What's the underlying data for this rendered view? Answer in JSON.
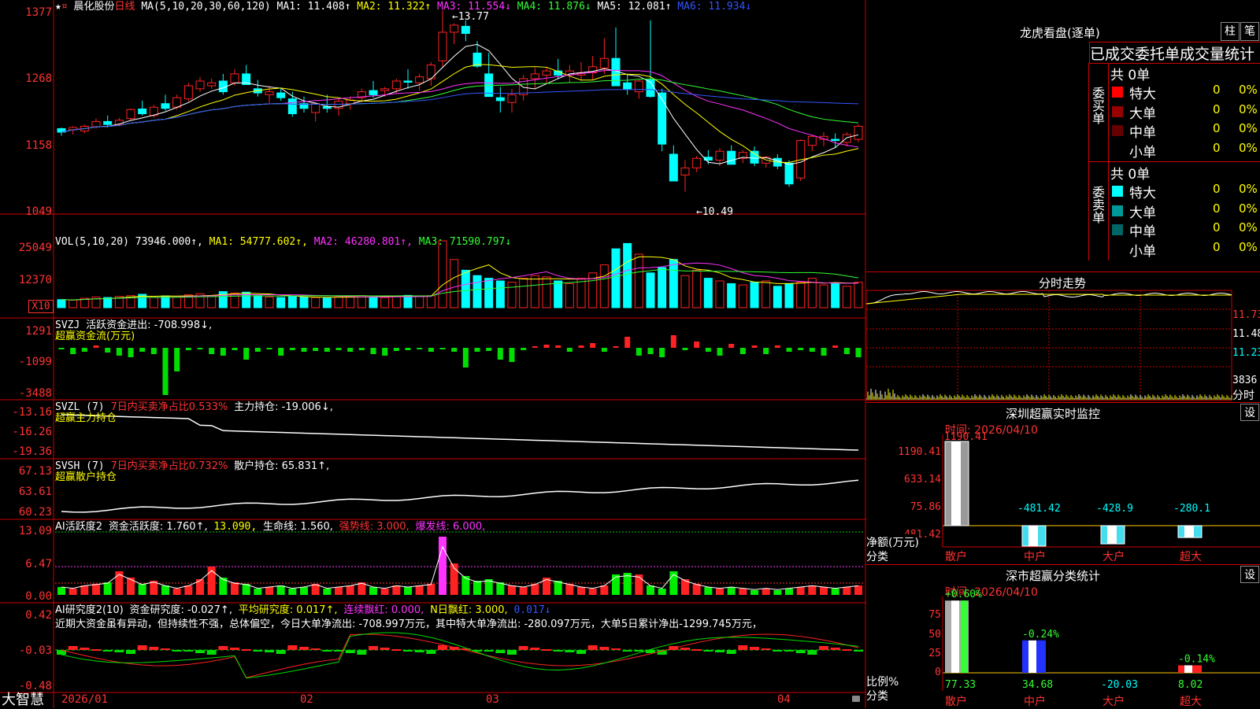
{
  "stock": {
    "name": "晨化股份",
    "period": "日线",
    "ma_header": "MA(5,10,20,30,60,120)",
    "ma": [
      {
        "label": "MA1: 11.408↑",
        "color": "#ffffff"
      },
      {
        "label": "MA2: 11.322↑",
        "color": "#ffff00"
      },
      {
        "label": "MA3: 11.554↓",
        "color": "#ff33ff"
      },
      {
        "label": "MA4: 11.876↓",
        "color": "#33ff33"
      },
      {
        "label": "MA5: 12.081↑",
        "color": "#ffffff"
      },
      {
        "label": "MA6: 11.934↓",
        "color": "#3355ff"
      }
    ],
    "high_mark": "←13.77",
    "low_mark": "←10.49",
    "price_axis": [
      "1377",
      "1268",
      "1158",
      "1049"
    ]
  },
  "vol": {
    "header": "VOL(5,10,20)",
    "value": "73946.000↑,",
    "ma1": "MA1: 54777.602↑,",
    "ma2": "MA2: 46280.801↑,",
    "ma3": "MA3: 71590.797↓",
    "axis": [
      "25049",
      "12370"
    ],
    "unit": "X10"
  },
  "svzj": {
    "header": "SVZJ",
    "line1": "活跃资金进出: -708.998↓,",
    "line2": "超赢资金流(万元)",
    "axis": [
      "1291",
      "-1099",
      "-3488"
    ]
  },
  "svzl": {
    "header": "SVZL (7)",
    "desc": "7日内买卖净占比0.533%",
    "val": "主力持仓: -19.006↓,",
    "line2": "超赢主力持仓",
    "axis": [
      "-13.16",
      "-16.26",
      "-19.36"
    ]
  },
  "svsh": {
    "header": "SVSH (7)",
    "desc": "7日内买卖净占比0.732%",
    "val": "散户持仓: 65.831↑,",
    "line2": "超赢散户持仓",
    "axis": [
      "67.13",
      "63.61",
      "60.23"
    ]
  },
  "ai1": {
    "header": "AI活跃度2",
    "a": "资金活跃度: 1.760↑,",
    "b": "13.090,",
    "c": "生命线: 1.560,",
    "d": "强势线: 3.000,",
    "e": "爆发线: 6.000,",
    "axis": [
      "13.09",
      "6.47",
      "0.00"
    ]
  },
  "ai2": {
    "header": "AI研究度2(10)",
    "a": "资金研究度: -0.027↑,",
    "b": "平均研究度: 0.017↑,",
    "c": "连续飘红: 0.000,",
    "d": "N日飘红: 3.000,",
    "e": "0.017↓",
    "summary": "近期大资金虽有异动，但持续性不强，总体偏空，今日大单净流出: -708.997万元，其中特大单净流出: -280.097万元，大单5日累计净出-1299.745万元，",
    "axis": [
      "0.42",
      "-0.03",
      "-0.48"
    ]
  },
  "footer": {
    "brand": "大智慧",
    "dates": [
      "2026/01",
      "02",
      "03",
      "04"
    ]
  },
  "lhb": {
    "title": "龙虎看盘(逐单)",
    "btn1": "柱",
    "btn2": "笔",
    "tabs": "已成交委托单成交量统计",
    "buy_label": "委买单",
    "sell_label": "委卖单",
    "buy_total": "共 0单",
    "sell_total": "共 0单",
    "buy_rows": [
      {
        "name": "特大",
        "count": "0",
        "pct": "0%",
        "color": "#ff0000"
      },
      {
        "name": "大单",
        "count": "0",
        "pct": "0%",
        "color": "#990000"
      },
      {
        "name": "中单",
        "count": "0",
        "pct": "0%",
        "color": "#660000"
      },
      {
        "name": "小单",
        "count": "0",
        "pct": "0%",
        "color": "#000000"
      }
    ],
    "sell_rows": [
      {
        "name": "特大",
        "count": "0",
        "pct": "0%",
        "color": "#00ffff"
      },
      {
        "name": "大单",
        "count": "0",
        "pct": "0%",
        "color": "#009999"
      },
      {
        "name": "中单",
        "count": "0",
        "pct": "0%",
        "color": "#006666"
      },
      {
        "name": "小单",
        "count": "0",
        "pct": "0%",
        "color": "#000000"
      }
    ]
  },
  "intraday": {
    "title": "分时走势",
    "axis": [
      "11.73",
      "11.48",
      "11.23",
      "3836"
    ],
    "unit": "分时"
  },
  "monitor": {
    "title": "深圳超赢实时监控",
    "btn": "设",
    "time": "时间: 2026/04/10",
    "axis": [
      "1190.41",
      "633.14",
      "75.86",
      "-481.42"
    ],
    "ylabel": "净额(万元)",
    "xlabel": "分类",
    "cats": [
      "散户",
      "中户",
      "大户",
      "超大"
    ],
    "values": [
      1190.41,
      -481.42,
      -428.9,
      -280.1
    ],
    "value_labels": [
      "1190.41",
      "-481.42",
      "-428.9",
      "-280.1"
    ]
  },
  "classify": {
    "title": "深市超赢分类统计",
    "btn": "设",
    "time": "时间: 2026/04/10",
    "axis": [
      "75",
      "50",
      "25",
      "0"
    ],
    "ylabel": "比例%",
    "xlabel": "分类",
    "cats": [
      "散户",
      "中户",
      "大户",
      "超大"
    ],
    "pct_labels": [
      "+0.60%",
      "-0.24%",
      "",
      "-0.14%"
    ],
    "values": [
      77.33,
      34.68,
      -20.03,
      8.02
    ],
    "value_labels": [
      "77.33",
      "34.68",
      "-20.03",
      "8.02"
    ]
  },
  "colors": {
    "up": "#ff2222",
    "down": "#00ffff",
    "panel_border": "#cc0000",
    "gold": "#ffff00"
  }
}
